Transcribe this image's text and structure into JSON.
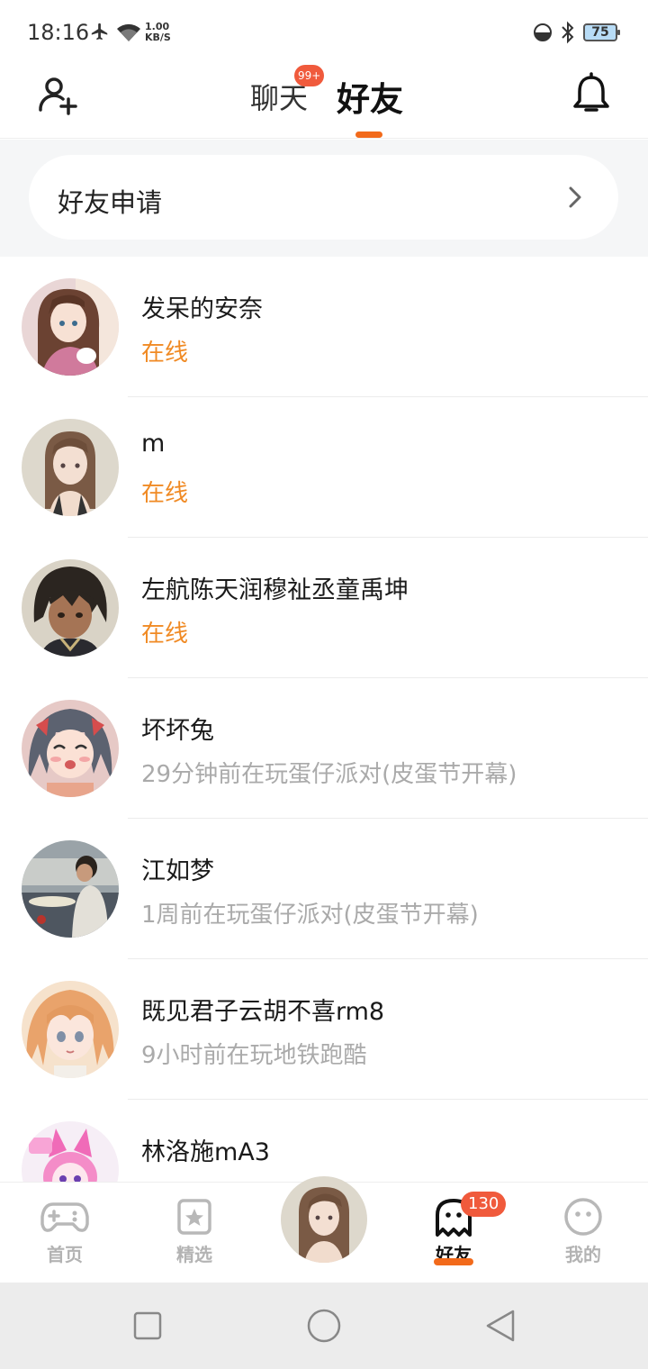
{
  "status_bar": {
    "time": "18:16",
    "net_speed_value": "1.00",
    "net_speed_unit": "KB/S",
    "battery": "75"
  },
  "header": {
    "tab_chat": "聊天",
    "tab_chat_badge": "99+",
    "tab_friends": "好友",
    "accent_color": "#f26a1b"
  },
  "friend_request": {
    "label": "好友申请"
  },
  "friends": [
    {
      "name": "发呆的安奈",
      "status": "在线",
      "online": true
    },
    {
      "name": "m",
      "status": "在线",
      "online": true
    },
    {
      "name": "左航陈天润穆祉丞童禹坤",
      "status": "在线",
      "online": true
    },
    {
      "name": "坏坏兔",
      "status": "29分钟前在玩蛋仔派对(皮蛋节开幕)",
      "online": false
    },
    {
      "name": "江如梦",
      "status": "1周前在玩蛋仔派对(皮蛋节开幕)",
      "online": false
    },
    {
      "name": "既见君子云胡不喜rm8",
      "status": "9小时前在玩地铁跑酷",
      "online": false
    },
    {
      "name": "林洛施mA3",
      "status": "",
      "online": false
    }
  ],
  "bottom_nav": {
    "home": "首页",
    "featured": "精选",
    "friends": "好友",
    "friends_badge": "130",
    "mine": "我的"
  }
}
